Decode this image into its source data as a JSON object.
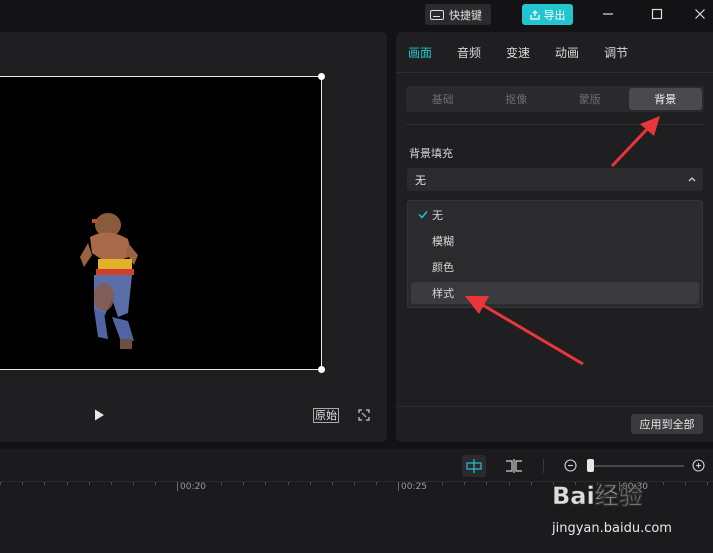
{
  "titlebar": {
    "hotkey_label": "快捷键",
    "export_label": "导出"
  },
  "player": {
    "original_label": "原始"
  },
  "panel": {
    "tabs": [
      {
        "label": "画面",
        "active": true
      },
      {
        "label": "音频",
        "active": false
      },
      {
        "label": "变速",
        "active": false
      },
      {
        "label": "动画",
        "active": false
      },
      {
        "label": "调节",
        "active": false
      }
    ],
    "subtabs": [
      {
        "label": "基础",
        "active": false
      },
      {
        "label": "抠像",
        "active": false
      },
      {
        "label": "蒙版",
        "active": false
      },
      {
        "label": "背景",
        "active": true
      }
    ],
    "background_fill_label": "背景填充",
    "select_value": "无",
    "options": [
      {
        "label": "无",
        "checked": true
      },
      {
        "label": "模糊",
        "checked": false
      },
      {
        "label": "颜色",
        "checked": false
      },
      {
        "label": "样式",
        "checked": false,
        "hovered": true
      }
    ],
    "apply_all_label": "应用到全部"
  },
  "timeline": {
    "ticks": [
      "00:20",
      "00:25",
      "00:30"
    ]
  },
  "watermark": {
    "brand": "Bai经验",
    "url": "jingyan.baidu.com"
  },
  "colors": {
    "accent": "#21c4cf",
    "panel_bg": "#1f1f22",
    "app_bg": "#131315",
    "arrow": "#e8363a"
  }
}
